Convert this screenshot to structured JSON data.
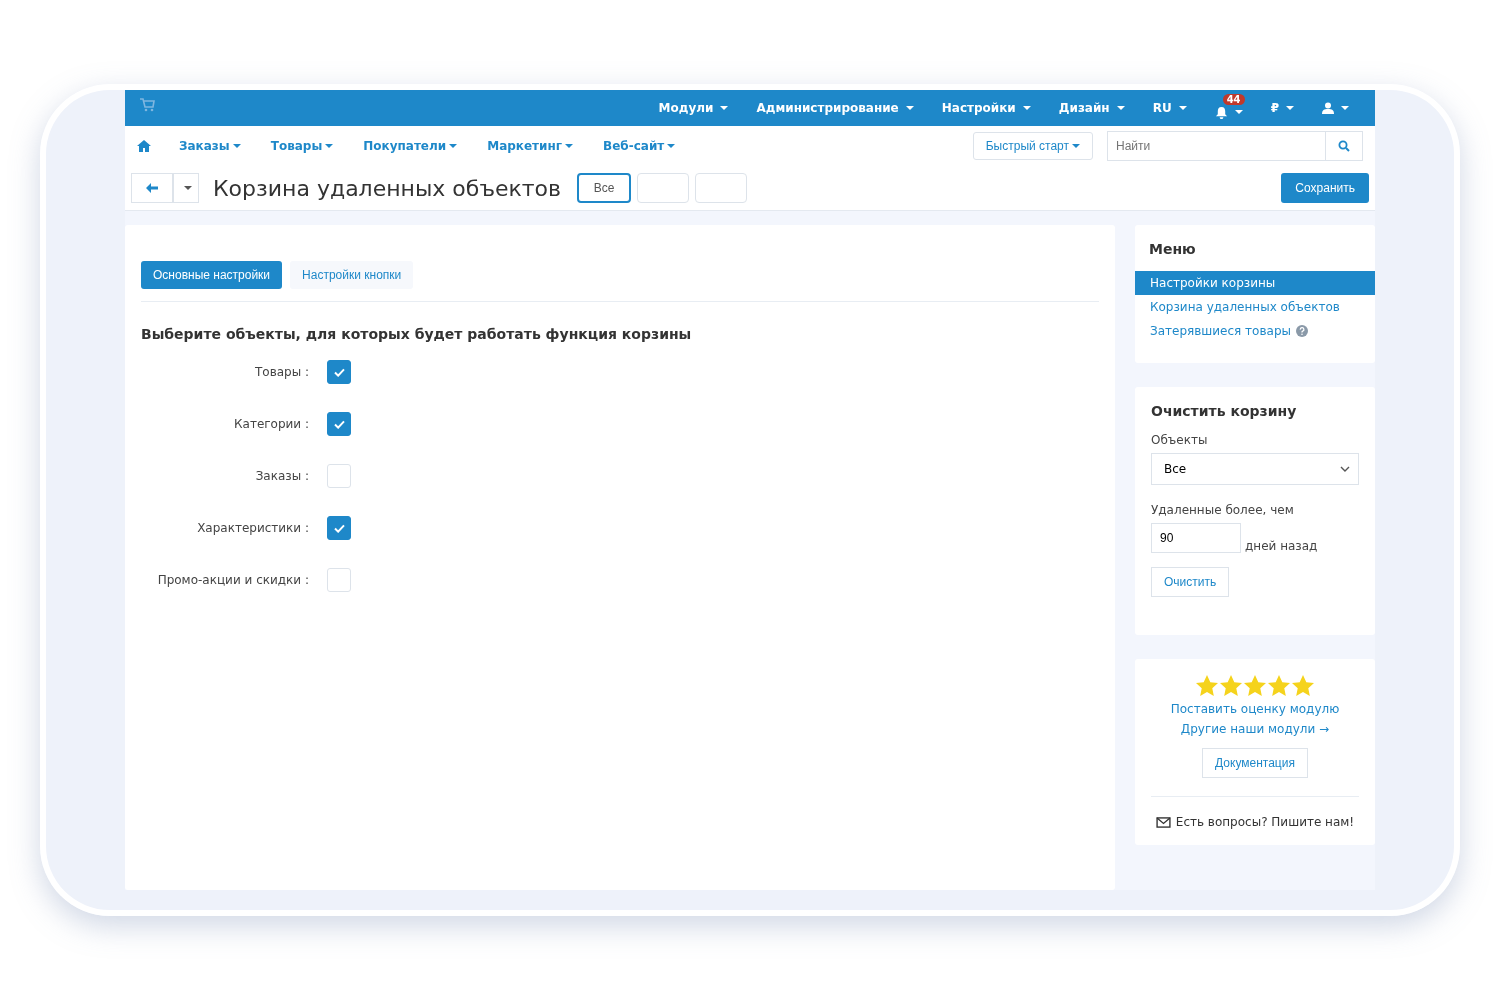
{
  "top_nav": {
    "items": [
      {
        "label": "Модули"
      },
      {
        "label": "Администрирование"
      },
      {
        "label": "Настройки"
      },
      {
        "label": "Дизайн"
      },
      {
        "label": "RU"
      }
    ],
    "notifications": "44",
    "currency": "₽"
  },
  "main_nav": {
    "items": [
      {
        "label": "Заказы"
      },
      {
        "label": "Товары"
      },
      {
        "label": "Покупатели"
      },
      {
        "label": "Маркетинг"
      },
      {
        "label": "Веб-сайт"
      }
    ],
    "quick_start": "Быстрый старт",
    "search": {
      "placeholder": "Найти"
    }
  },
  "page": {
    "title": "Корзина удаленных объектов",
    "filters": [
      {
        "label": "Все",
        "selected": true
      }
    ],
    "save": "Сохранить"
  },
  "tabs": [
    {
      "label": "Основные настройки",
      "selected": true
    },
    {
      "label": "Настройки кнопки",
      "selected": false
    }
  ],
  "section_title": "Выберите объекты, для которых будет работать функция корзины",
  "options": [
    {
      "label": "Товары :",
      "checked": true
    },
    {
      "label": "Категории :",
      "checked": true
    },
    {
      "label": "Заказы :",
      "checked": false
    },
    {
      "label": "Характеристики :",
      "checked": true
    },
    {
      "label": "Промо-акции и скидки :",
      "checked": false
    }
  ],
  "menu": {
    "title": "Меню",
    "items": [
      {
        "label": "Настройки корзины",
        "selected": true,
        "help": false
      },
      {
        "label": "Корзина удаленных объектов",
        "selected": false,
        "help": false
      },
      {
        "label": "Затерявшиеся товары",
        "selected": false,
        "help": true
      }
    ]
  },
  "clear": {
    "title": "Очистить корзину",
    "objects_label": "Объекты",
    "objects_value": "Все",
    "older_label": "Удаленные более, чем",
    "days_value": "90",
    "days_suffix": "дней назад",
    "button": "Очистить"
  },
  "rating": {
    "stars": 5,
    "rate_link": "Поставить оценку модулю",
    "other_link": "Другие наши модули →",
    "docs": "Документация",
    "contact": "Есть вопросы? Пишите нам!"
  }
}
